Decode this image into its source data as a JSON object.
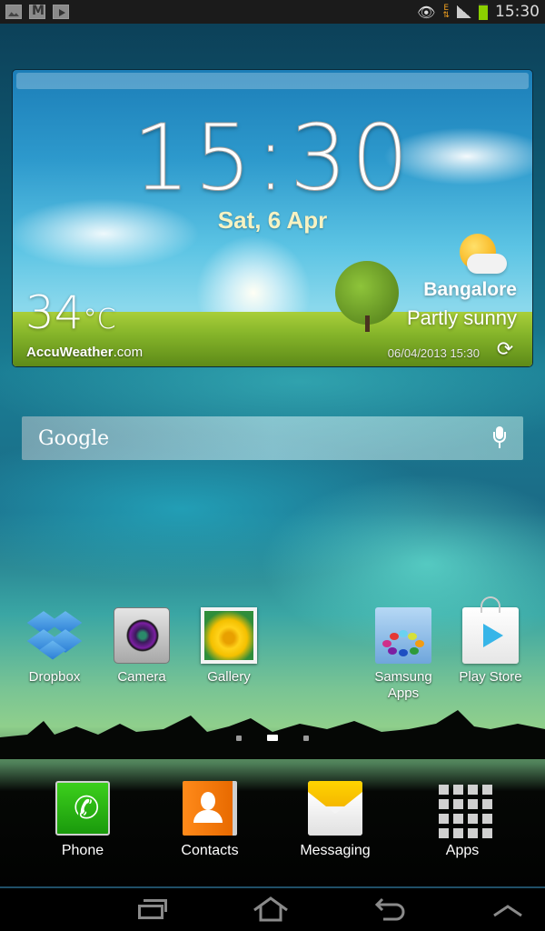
{
  "status_bar": {
    "left_icons": [
      "gallery-icon",
      "gmail-icon",
      "play-store-icon"
    ],
    "right_icons": [
      "eye-smart-stay-icon",
      "edge-data-icon",
      "signal-icon",
      "battery-icon"
    ],
    "data_label": "E",
    "time": "15:30",
    "battery_color": "#8bd000"
  },
  "weather_widget": {
    "time": "15:30",
    "date": "Sat, 6 Apr",
    "temperature": "34",
    "temperature_unit": "°C",
    "provider": "AccuWeather",
    "provider_suffix": ".com",
    "city": "Bangalore",
    "condition": "Partly sunny",
    "updated": "06/04/2013 15:30",
    "condition_icon": "partly-sunny-icon",
    "refresh_icon": "refresh-icon"
  },
  "search": {
    "label": "Google",
    "mic_icon": "microphone-icon"
  },
  "home_apps": [
    {
      "label": "Dropbox",
      "icon": "dropbox-icon"
    },
    {
      "label": "Camera",
      "icon": "camera-icon"
    },
    {
      "label": "Gallery",
      "icon": "gallery-icon"
    },
    {
      "label": "Samsung Apps",
      "icon": "samsung-apps-icon"
    },
    {
      "label": "Play Store",
      "icon": "play-store-icon"
    }
  ],
  "pager": {
    "pages": 3,
    "current": 2
  },
  "dock": [
    {
      "label": "Phone",
      "icon": "phone-icon"
    },
    {
      "label": "Contacts",
      "icon": "contacts-icon"
    },
    {
      "label": "Messaging",
      "icon": "messaging-icon"
    },
    {
      "label": "Apps",
      "icon": "apps-grid-icon"
    }
  ],
  "nav_bar": [
    "recent-apps-icon",
    "home-icon",
    "back-icon",
    "up-arrow-icon"
  ]
}
